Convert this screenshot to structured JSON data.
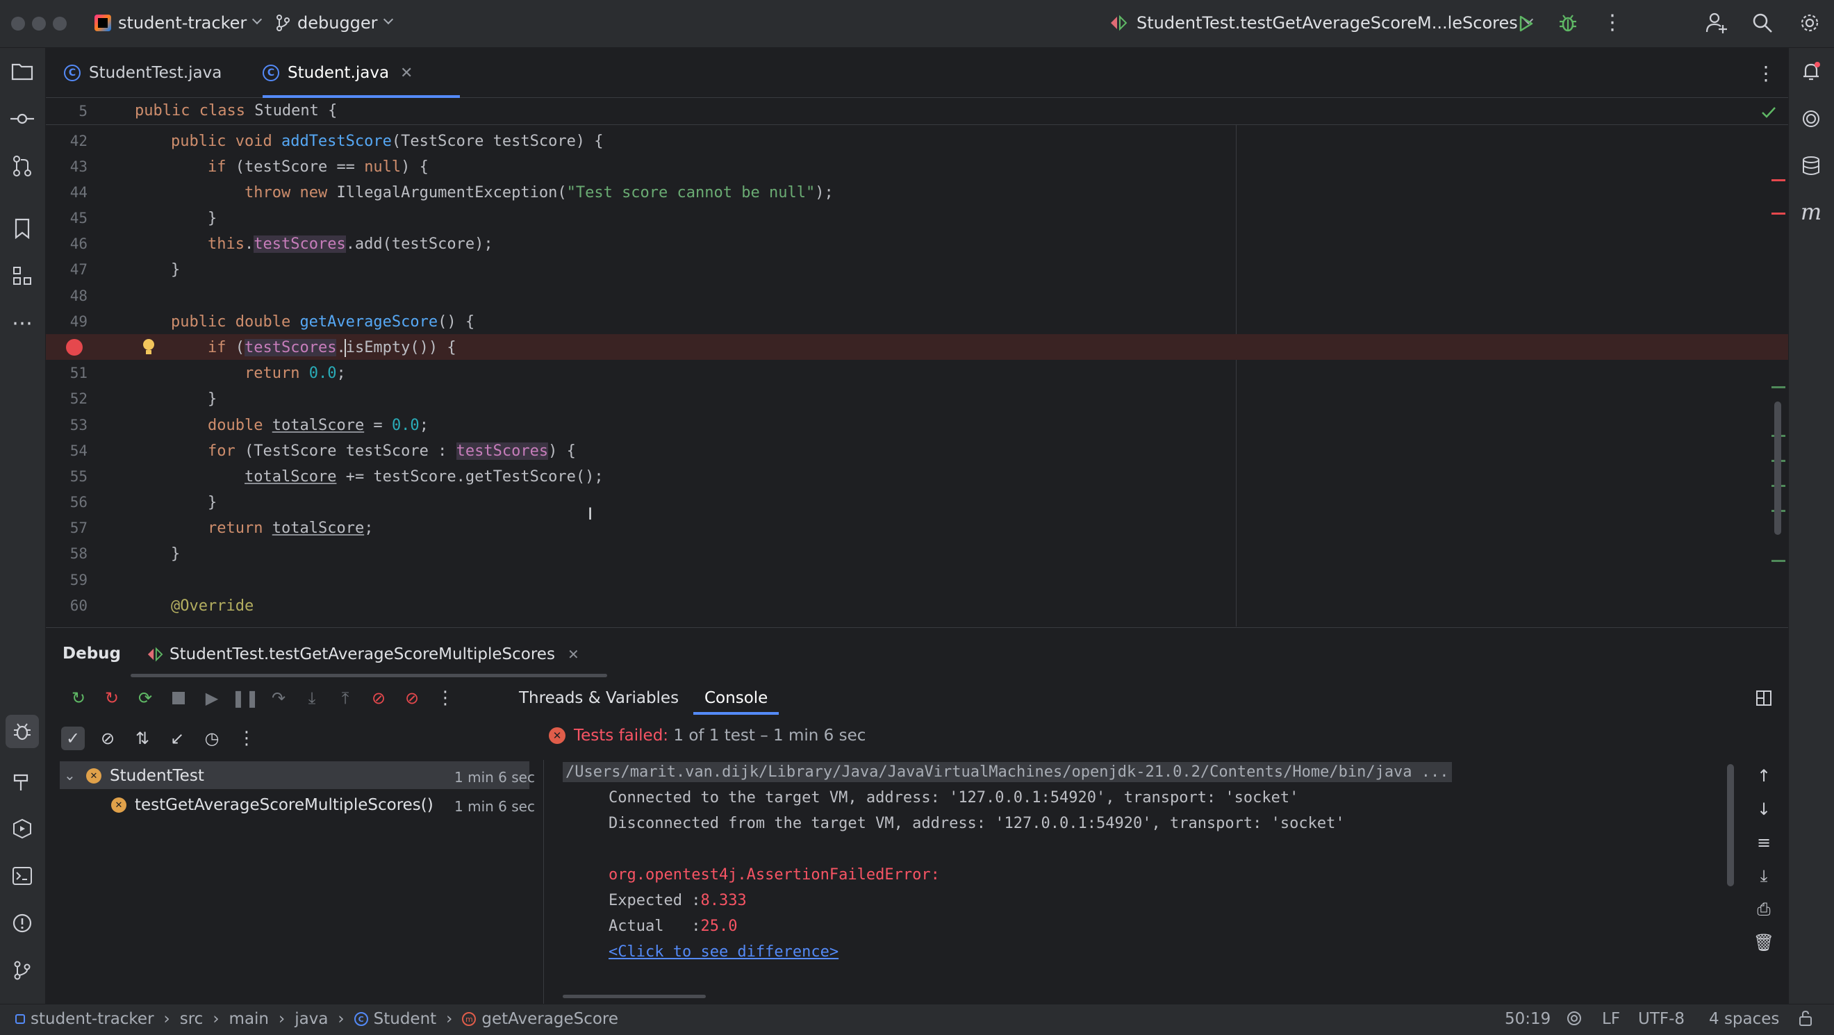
{
  "titlebar": {
    "project_name": "student-tracker",
    "branch": "debugger",
    "run_config": "StudentTest.testGetAverageScoreM...leScores"
  },
  "tabs": [
    {
      "label": "StudentTest.java",
      "active": false
    },
    {
      "label": "Student.java",
      "active": true
    }
  ],
  "editor": {
    "sticky_line_number": "5",
    "sticky_line": "public class Student {",
    "lines": [
      {
        "n": "42"
      },
      {
        "n": "43"
      },
      {
        "n": "44"
      },
      {
        "n": "45"
      },
      {
        "n": "46"
      },
      {
        "n": "47"
      },
      {
        "n": "48"
      },
      {
        "n": "49"
      },
      {
        "n": "50"
      },
      {
        "n": "51"
      },
      {
        "n": "52"
      },
      {
        "n": "53"
      },
      {
        "n": "54"
      },
      {
        "n": "55"
      },
      {
        "n": "56"
      },
      {
        "n": "57"
      },
      {
        "n": "58"
      },
      {
        "n": "59"
      },
      {
        "n": "60"
      }
    ],
    "string_literal": "\"Test score cannot be null\"",
    "annotation": "@Override"
  },
  "debug": {
    "title": "Debug",
    "session_tab": "StudentTest.testGetAverageScoreMultipleScores",
    "tabs": [
      "Threads & Variables",
      "Console"
    ],
    "status_text": "Tests failed: 1 of 1 test – 1 min 6 sec",
    "status_bold": "Tests failed:",
    "status_rest": " 1 of 1 test – 1 min 6 sec",
    "tree": [
      {
        "label": "StudentTest",
        "time": "1 min 6 sec"
      },
      {
        "label": "testGetAverageScoreMultipleScores()",
        "time": "1 min 6 sec"
      }
    ],
    "console": {
      "cmd": "/Users/marit.van.dijk/Library/Java/JavaVirtualMachines/openjdk-21.0.2/Contents/Home/bin/java ...",
      "connected": "Connected to the target VM, address: '127.0.0.1:54920', transport: 'socket'",
      "disconnected": "Disconnected from the target VM, address: '127.0.0.1:54920', transport: 'socket'",
      "error": "org.opentest4j.AssertionFailedError:",
      "expected_label": "Expected :",
      "expected_value": "8.333",
      "actual_label": "Actual   :",
      "actual_value": "25.0",
      "diff_link": "<Click to see difference>"
    }
  },
  "statusbar": {
    "breadcrumbs": [
      "student-tracker",
      "src",
      "main",
      "java",
      "Student",
      "getAverageScore"
    ],
    "position": "50:19",
    "line_sep": "LF",
    "encoding": "UTF-8",
    "indent": "4 spaces"
  },
  "colors": {
    "background": "#1e1f22",
    "panel": "#2b2d30",
    "accent": "#548af7",
    "error": "#f75464",
    "run_green": "#5fb865"
  }
}
